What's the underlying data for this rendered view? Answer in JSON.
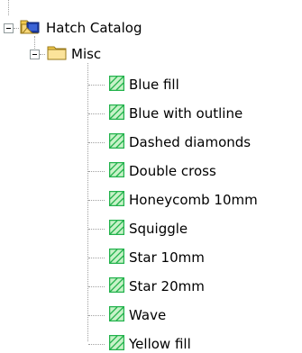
{
  "tree": {
    "root": {
      "label": "Hatch Catalog",
      "expanded": true,
      "icon": "catalog-folder-icon"
    },
    "group": {
      "label": "Misc",
      "expanded": true,
      "icon": "folder-icon"
    },
    "items": [
      {
        "label": "Blue fill",
        "icon": "hatch-icon"
      },
      {
        "label": "Blue with outline",
        "icon": "hatch-icon"
      },
      {
        "label": "Dashed diamonds",
        "icon": "hatch-icon"
      },
      {
        "label": "Double cross",
        "icon": "hatch-icon"
      },
      {
        "label": "Honeycomb 10mm",
        "icon": "hatch-icon"
      },
      {
        "label": "Squiggle",
        "icon": "hatch-icon"
      },
      {
        "label": "Star 10mm",
        "icon": "hatch-icon"
      },
      {
        "label": "Star 20mm",
        "icon": "hatch-icon"
      },
      {
        "label": "Wave",
        "icon": "hatch-icon"
      },
      {
        "label": "Yellow fill",
        "icon": "hatch-icon"
      }
    ]
  },
  "colors": {
    "hatch_border": "#22b24c",
    "hatch_fill": "#c8f2c8",
    "folder_yellow": "#f7d77a",
    "catalog_blue": "#1f3fa8",
    "connector": "#a0a0a0"
  }
}
